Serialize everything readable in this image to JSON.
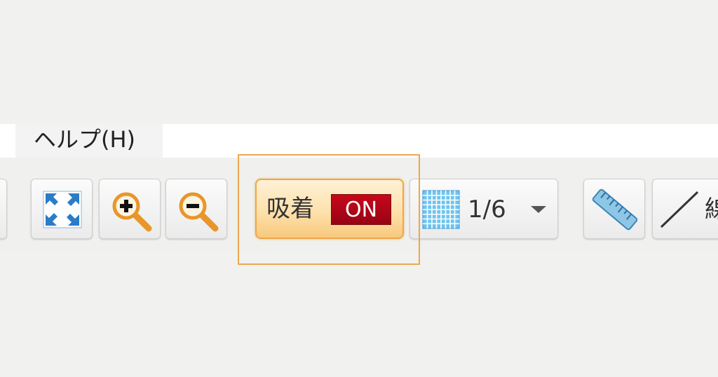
{
  "menu": {
    "help_label": "ヘルプ(H)"
  },
  "toolbar": {
    "fit": {
      "icon": "fit-to-screen-icon"
    },
    "zoom_in": {
      "icon": "zoom-in-icon"
    },
    "zoom_out": {
      "icon": "zoom-out-icon"
    },
    "snap": {
      "label": "吸着",
      "state": "ON",
      "state_color": "#b0061a"
    },
    "grid": {
      "icon": "grid-icon",
      "value": "1/6"
    },
    "ruler": {
      "icon": "ruler-icon"
    },
    "line_tool": {
      "icon": "line-tool-icon",
      "label": "線"
    }
  },
  "colors": {
    "accent": "#f0a64b",
    "icon_blue": "#2a7cc7",
    "magnifier_orange": "#e8962a"
  }
}
